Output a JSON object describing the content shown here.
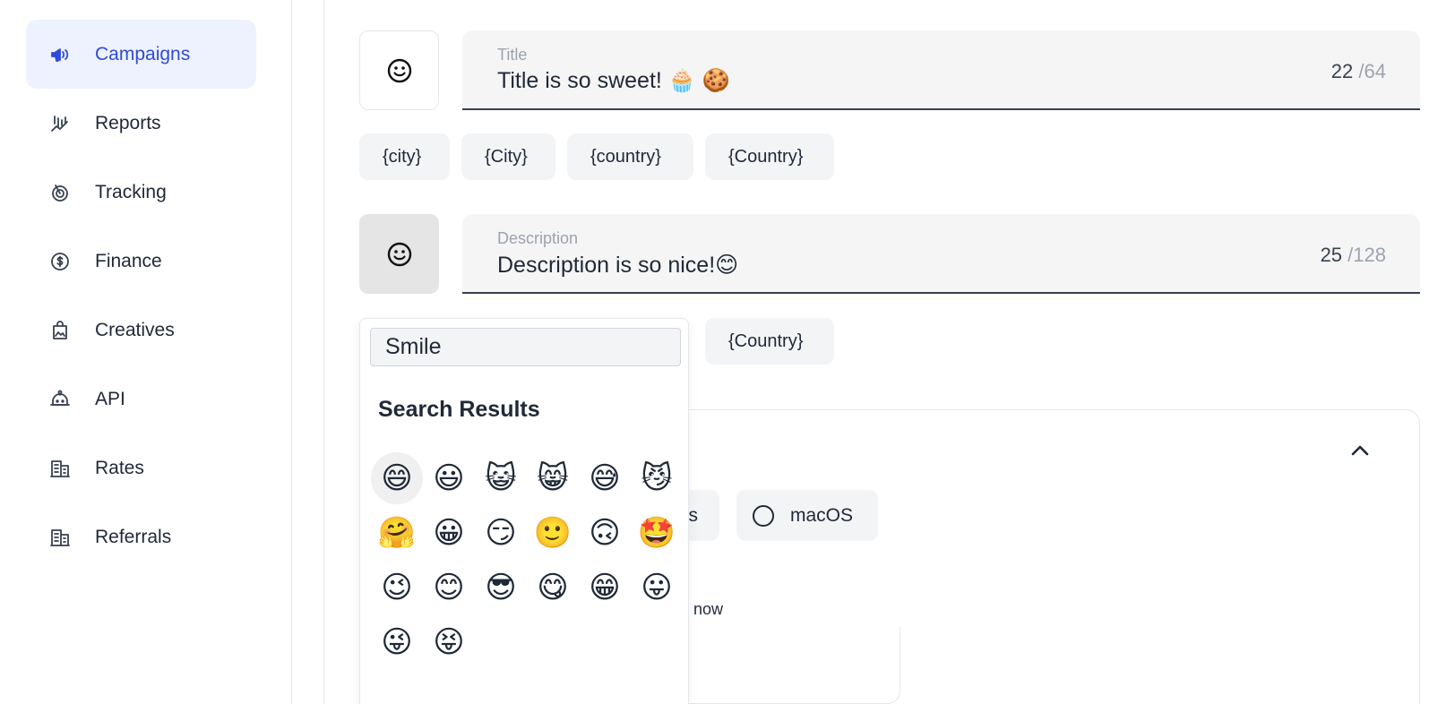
{
  "sidebar": {
    "items": [
      {
        "label": "Campaigns",
        "icon": "megaphone-icon",
        "active": true
      },
      {
        "label": "Reports",
        "icon": "chart-icon"
      },
      {
        "label": "Tracking",
        "icon": "radar-icon"
      },
      {
        "label": "Finance",
        "icon": "coin-icon"
      },
      {
        "label": "Creatives",
        "icon": "image-bag-icon"
      },
      {
        "label": "API",
        "icon": "robot-icon"
      },
      {
        "label": "Rates",
        "icon": "building-icon"
      },
      {
        "label": "Referrals",
        "icon": "building-icon"
      }
    ]
  },
  "title_field": {
    "label": "Title",
    "value": "Title is so sweet! 🧁 🍪",
    "count": "22",
    "max": "/64"
  },
  "title_chips": [
    "{city}",
    "{City}",
    "{country}",
    "{Country}"
  ],
  "description_field": {
    "label": "Description",
    "value": "Description is so nice!😊",
    "count": "25",
    "max": "/128"
  },
  "description_chips": [
    "{Country}"
  ],
  "os_options": {
    "partial_label": "s",
    "macos_label": "macOS"
  },
  "now_text": "now",
  "emoji_picker": {
    "search_value": "Smile",
    "heading": "Search Results",
    "emojis": [
      "😄",
      "😃",
      "😺",
      "😸",
      "😅",
      "😼",
      "🤗",
      "😀",
      "😏",
      "🙂",
      "🙃",
      "🤩",
      "😉",
      "😊",
      "😎",
      "😋",
      "😁",
      "😛",
      "😜",
      "😝"
    ]
  }
}
